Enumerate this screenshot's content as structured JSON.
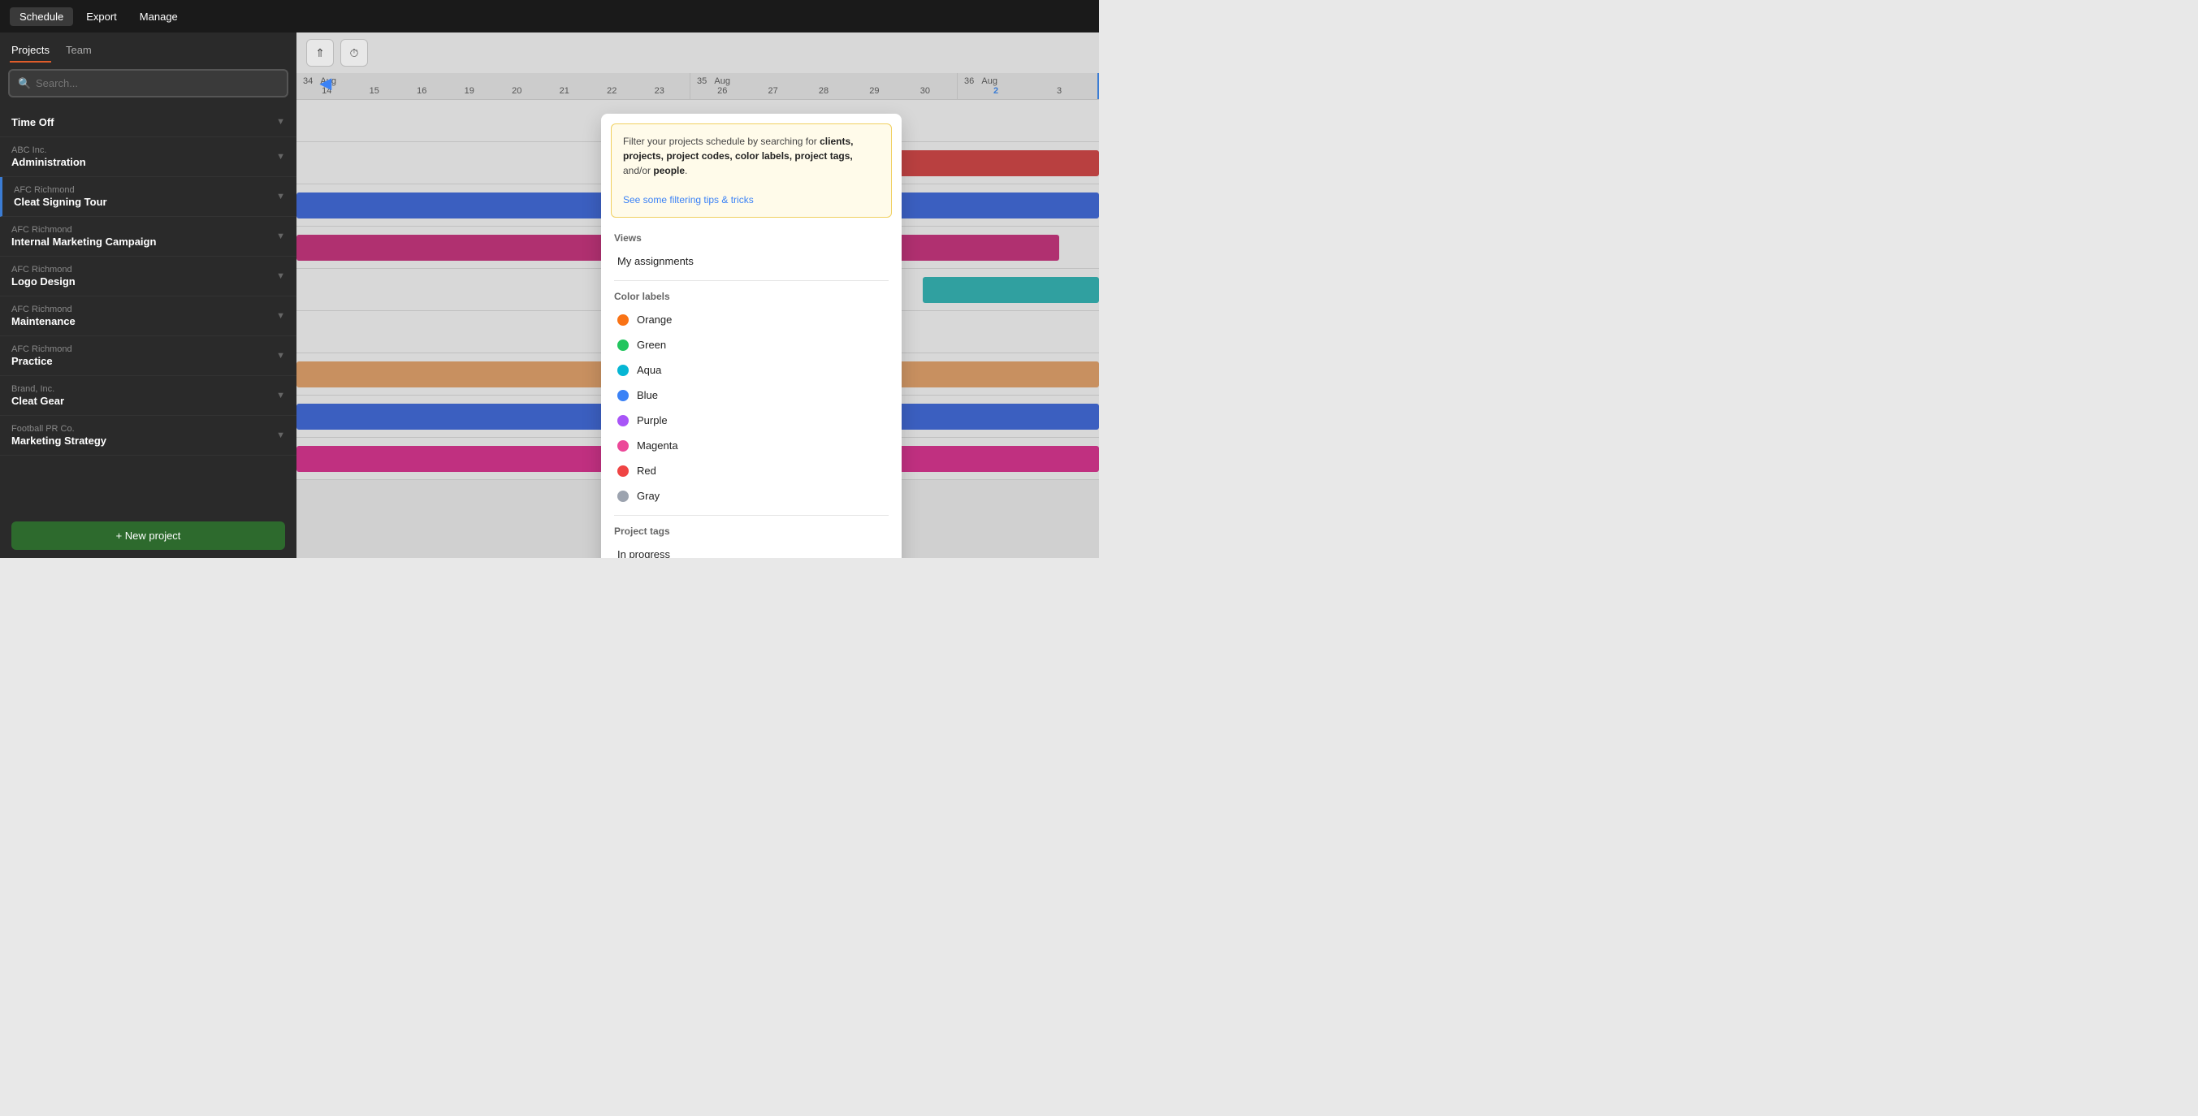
{
  "topNav": {
    "buttons": [
      {
        "id": "schedule",
        "label": "Schedule",
        "active": true
      },
      {
        "id": "export",
        "label": "Export",
        "active": false
      },
      {
        "id": "manage",
        "label": "Manage",
        "active": false
      }
    ]
  },
  "sidebar": {
    "tabs": [
      {
        "id": "projects",
        "label": "Projects",
        "active": true
      },
      {
        "id": "team",
        "label": "Team",
        "active": false
      }
    ],
    "search": {
      "placeholder": "Search..."
    },
    "projects": [
      {
        "id": "time-off",
        "client": "",
        "name": "Time Off"
      },
      {
        "id": "abc-admin",
        "client": "ABC Inc.",
        "name": "Administration"
      },
      {
        "id": "afc-cleat",
        "client": "AFC Richmond",
        "name": "Cleat Signing Tour",
        "hasBar": true
      },
      {
        "id": "afc-marketing",
        "client": "AFC Richmond",
        "name": "Internal Marketing Campaign"
      },
      {
        "id": "afc-logo",
        "client": "AFC Richmond",
        "name": "Logo Design"
      },
      {
        "id": "afc-maintenance",
        "client": "AFC Richmond",
        "name": "Maintenance"
      },
      {
        "id": "afc-practice",
        "client": "AFC Richmond",
        "name": "Practice"
      },
      {
        "id": "brand-cleat",
        "client": "Brand, Inc.",
        "name": "Cleat Gear"
      },
      {
        "id": "football-marketing",
        "client": "Football PR Co.",
        "name": "Marketing Strategy"
      }
    ],
    "newProjectBtn": "+ New project"
  },
  "calendar": {
    "toolbarBtns": [
      {
        "id": "scroll-up",
        "icon": "⇑"
      },
      {
        "id": "clock",
        "icon": "🕐"
      }
    ],
    "weeks": [
      {
        "num": "34",
        "month": "Aug",
        "days": [
          "14",
          "15",
          "16",
          "19",
          "20",
          "21",
          "22",
          "23"
        ]
      },
      {
        "num": "35",
        "month": "Aug",
        "days": [
          "26",
          "27",
          "28",
          "29",
          "30"
        ]
      },
      {
        "num": "36",
        "month": "Aug",
        "days": [
          "2",
          "3"
        ]
      }
    ]
  },
  "dropdown": {
    "hint": {
      "text_prefix": "Filter your projects schedule by searching for ",
      "bold_items": "clients, projects, project codes, color labels, project tags,",
      "text_suffix": " and/or ",
      "bold_suffix": "people",
      "text_end": ".",
      "link_label": "See some filtering tips & tricks"
    },
    "views": {
      "section_label": "Views",
      "items": [
        {
          "id": "my-assignments",
          "label": "My assignments"
        }
      ]
    },
    "colorLabels": {
      "section_label": "Color labels",
      "items": [
        {
          "id": "orange",
          "label": "Orange",
          "color": "#f97316"
        },
        {
          "id": "green",
          "label": "Green",
          "color": "#22c55e"
        },
        {
          "id": "aqua",
          "label": "Aqua",
          "color": "#06b6d4"
        },
        {
          "id": "blue",
          "label": "Blue",
          "color": "#3b82f6"
        },
        {
          "id": "purple",
          "label": "Purple",
          "color": "#a855f7"
        },
        {
          "id": "magenta",
          "label": "Magenta",
          "color": "#ec4899"
        },
        {
          "id": "red",
          "label": "Red",
          "color": "#ef4444"
        },
        {
          "id": "gray",
          "label": "Gray",
          "color": "#9ca3af"
        }
      ]
    },
    "projectTags": {
      "section_label": "Project tags",
      "items": [
        {
          "id": "in-progress",
          "label": "In progress"
        }
      ]
    }
  }
}
